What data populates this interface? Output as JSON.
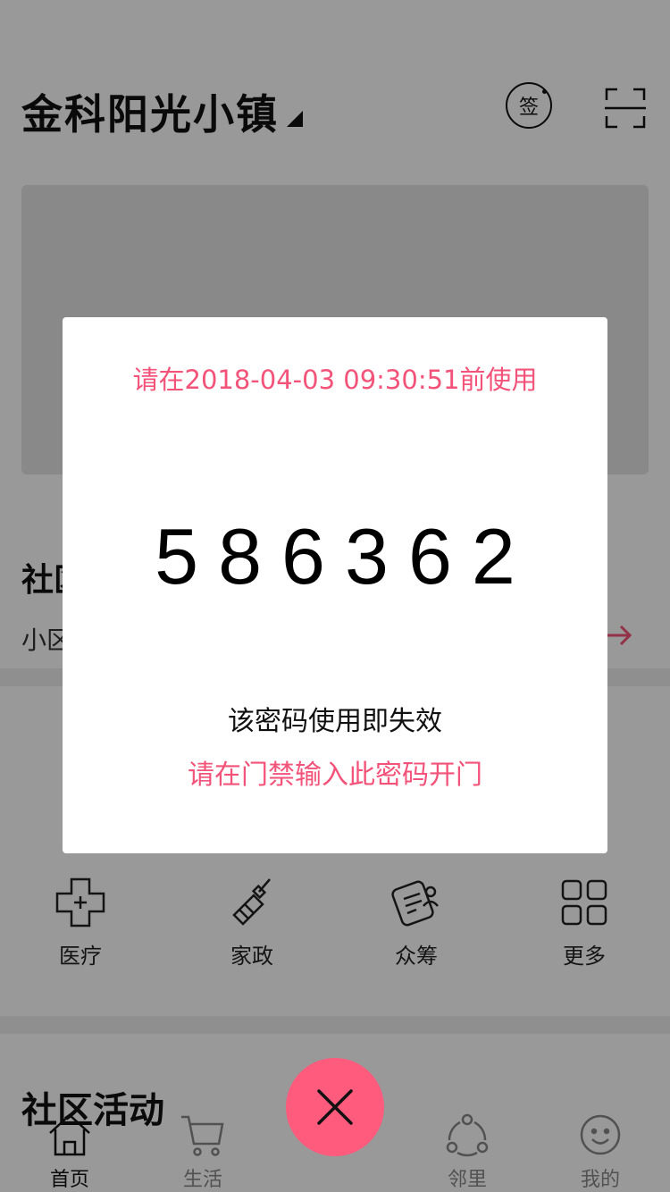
{
  "header": {
    "community_name": "金科阳光小镇",
    "sign_label": "签",
    "sign_icon": "sign-in-icon",
    "scan_icon": "scan-icon"
  },
  "notice": {
    "title_visible": "社区",
    "subtitle_visible": "小区"
  },
  "services": [
    {
      "label": "医疗",
      "icon": "medical-icon"
    },
    {
      "label": "家政",
      "icon": "broom-icon"
    },
    {
      "label": "众筹",
      "icon": "crowdfunding-icon"
    },
    {
      "label": "更多",
      "icon": "grid-more-icon"
    }
  ],
  "activity": {
    "title": "社区活动"
  },
  "tabbar": {
    "items": [
      {
        "label": "首页",
        "icon": "home-icon",
        "active": true
      },
      {
        "label": "生活",
        "icon": "cart-icon",
        "active": false
      },
      {
        "label": "邻里",
        "icon": "share-icon",
        "active": false
      },
      {
        "label": "我的",
        "icon": "smile-icon",
        "active": false
      }
    ]
  },
  "dialog": {
    "expire_text": "请在2018-04-03 09:30:51前使用",
    "code": "586362",
    "note": "该密码使用即失效",
    "hint": "请在门禁输入此密码开门"
  },
  "colors": {
    "accent": "#f35379",
    "fab": "#fe5b7d",
    "mask": "rgba(0,0,0,0.4)"
  }
}
